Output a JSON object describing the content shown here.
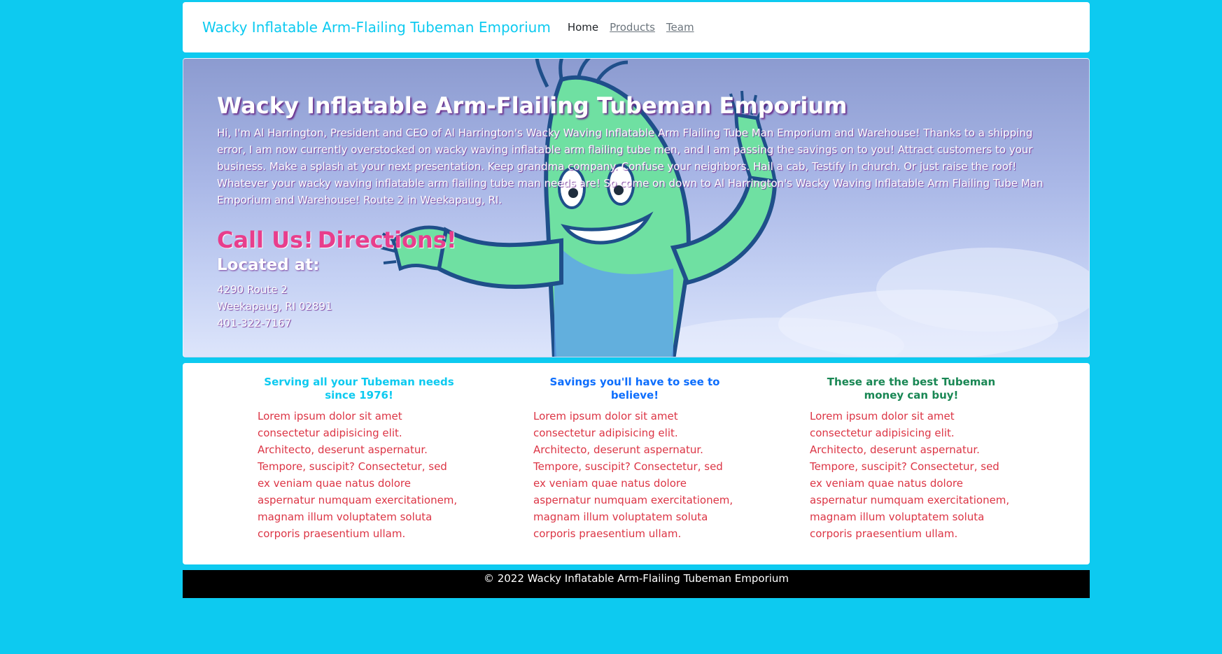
{
  "nav": {
    "brand": "Wacky Inflatable Arm-Flailing Tubeman Emporium",
    "links": [
      "Home",
      "Products",
      "Team"
    ]
  },
  "hero": {
    "title": "Wacky Inflatable Arm-Flailing Tubeman Emporium",
    "text": "Hi, I'm Al Harrington, President and CEO of Al Harrington's Wacky Waving Inflatable Arm Flailing Tube Man Emporium and Warehouse! Thanks to a shipping error, I am now currently overstocked on wacky waving inflatable arm flailing tube men, and I am passing the savings on to you! Attract customers to your business. Make a splash at your next presentation. Keep grandma company. Confuse your neighbors. Hail a cab, Testify in church. Or just raise the roof! Whatever your wacky waving inflatable arm flailing tube man needs are! So come on down to Al Harrington's Wacky Waving Inflatable Arm Flailing Tube Man Emporium and Warehouse! Route 2 in Weekapaug, RI.",
    "call_us": "Call Us!",
    "directions": "Directions!",
    "located_heading": "Located at:",
    "address_line1": "4290 Route 2",
    "address_line2": "Weekapaug, RI 02891",
    "phone": "401-322-7167"
  },
  "features": [
    {
      "heading": "Serving all your Tubeman needs since 1976!",
      "body": "Lorem ipsum dolor sit amet consectetur adipisicing elit. Architecto, deserunt aspernatur. Tempore, suscipit? Consectetur, sed ex veniam quae natus dolore aspernatur numquam exercitationem, magnam illum voluptatem soluta corporis praesentium ullam."
    },
    {
      "heading": "Savings you'll have to see to believe!",
      "body": "Lorem ipsum dolor sit amet consectetur adipisicing elit. Architecto, deserunt aspernatur. Tempore, suscipit? Consectetur, sed ex veniam quae natus dolore aspernatur numquam exercitationem, magnam illum voluptatem soluta corporis praesentium ullam."
    },
    {
      "heading": "These are the best Tubeman money can buy!",
      "body": "Lorem ipsum dolor sit amet consectetur adipisicing elit. Architecto, deserunt aspernatur. Tempore, suscipit? Consectetur, sed ex veniam quae natus dolore aspernatur numquam exercitationem, magnam illum voluptatem soluta corporis praesentium ullam."
    }
  ],
  "footer": {
    "text": "© 2022 Wacky Inflatable Arm-Flailing Tubeman Emporium"
  },
  "colors": {
    "page_background": "#0dcaf0",
    "brand": "#0dcaf0",
    "call_to_action": "#e83e8c",
    "feature_1_heading": "#0dcaf0",
    "feature_2_heading": "#0d6efd",
    "feature_3_heading": "#198754",
    "feature_body": "#dc3545",
    "footer_background": "#000000"
  },
  "hero_image": "inflatable-tube-man-illustration"
}
